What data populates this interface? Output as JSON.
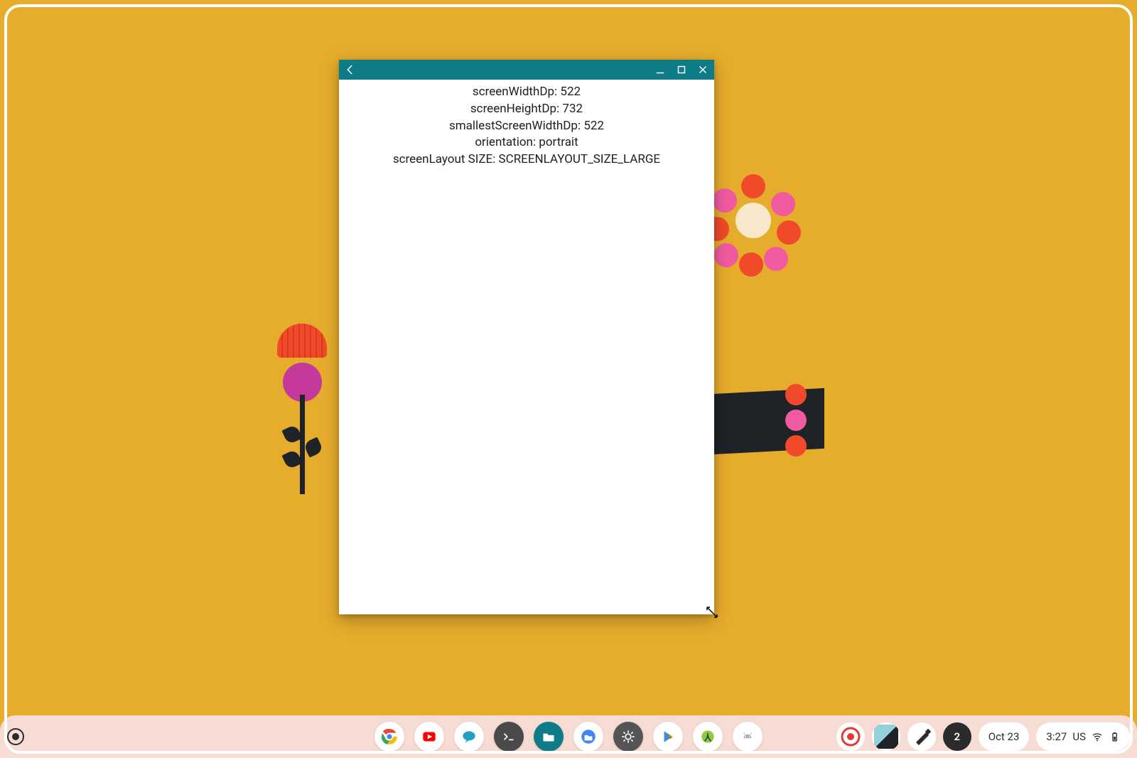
{
  "wallpaper": {
    "accent": "#e6ac2c"
  },
  "window": {
    "titlebar_color": "#0e7c86",
    "lines": [
      {
        "label": "screenWidthDp",
        "value": "522"
      },
      {
        "label": "screenHeightDp",
        "value": "732"
      },
      {
        "label": "smallestScreenWidthDp",
        "value": "522"
      },
      {
        "label": "orientation",
        "value": "portrait"
      },
      {
        "label": "screenLayout SIZE",
        "value": "SCREENLAYOUT_SIZE_LARGE"
      }
    ]
  },
  "shelf": {
    "apps": [
      {
        "name": "chrome",
        "label": "Chrome"
      },
      {
        "name": "youtube",
        "label": "YouTube"
      },
      {
        "name": "chat",
        "label": "Chat"
      },
      {
        "name": "terminal",
        "label": "Terminal"
      },
      {
        "name": "files-teal",
        "label": "Files"
      },
      {
        "name": "files",
        "label": "Files"
      },
      {
        "name": "settings",
        "label": "Settings"
      },
      {
        "name": "play",
        "label": "Play Store"
      },
      {
        "name": "studio",
        "label": "Android Studio"
      },
      {
        "name": "android",
        "label": "Android"
      }
    ],
    "notification_count": "2",
    "date": "Oct 23",
    "time": "3:27",
    "locale": "US"
  }
}
